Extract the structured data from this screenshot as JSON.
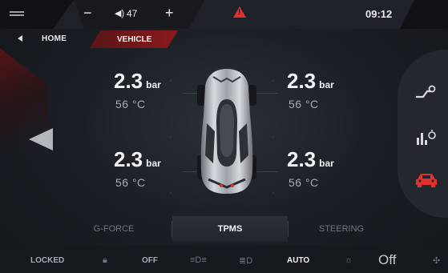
{
  "topbar": {
    "volume_minus": "−",
    "volume_value": "47",
    "volume_plus": "+",
    "volume_icon": "speaker-icon",
    "warning_icon": "warning-icon",
    "clock": "09:12"
  },
  "nav": {
    "home_label": "HOME",
    "vehicle_label": "VEHICLE"
  },
  "tpms": {
    "front_left": {
      "pressure": "2.3",
      "unit": "bar",
      "temp": "56 °C"
    },
    "front_right": {
      "pressure": "2.3",
      "unit": "bar",
      "temp": "56 °C"
    },
    "rear_left": {
      "pressure": "2.3",
      "unit": "bar",
      "temp": "56 °C"
    },
    "rear_right": {
      "pressure": "2.3",
      "unit": "bar",
      "temp": "56 °C"
    }
  },
  "tabs": [
    {
      "label": "G-FORCE",
      "active": false
    },
    {
      "label": "TPMS",
      "active": true
    },
    {
      "label": "STEERING",
      "active": false
    }
  ],
  "right_panel": {
    "items": [
      "route-icon",
      "chart-timer-icon",
      "car-icon"
    ],
    "active_color": "#e0312f"
  },
  "status": {
    "locked": "LOCKED",
    "off": "OFF",
    "auto": "AUTO",
    "fan_value": "Off"
  },
  "colors": {
    "accent": "#e0312f",
    "accent_dark": "#8a1a1d",
    "background": "#1c2026"
  }
}
